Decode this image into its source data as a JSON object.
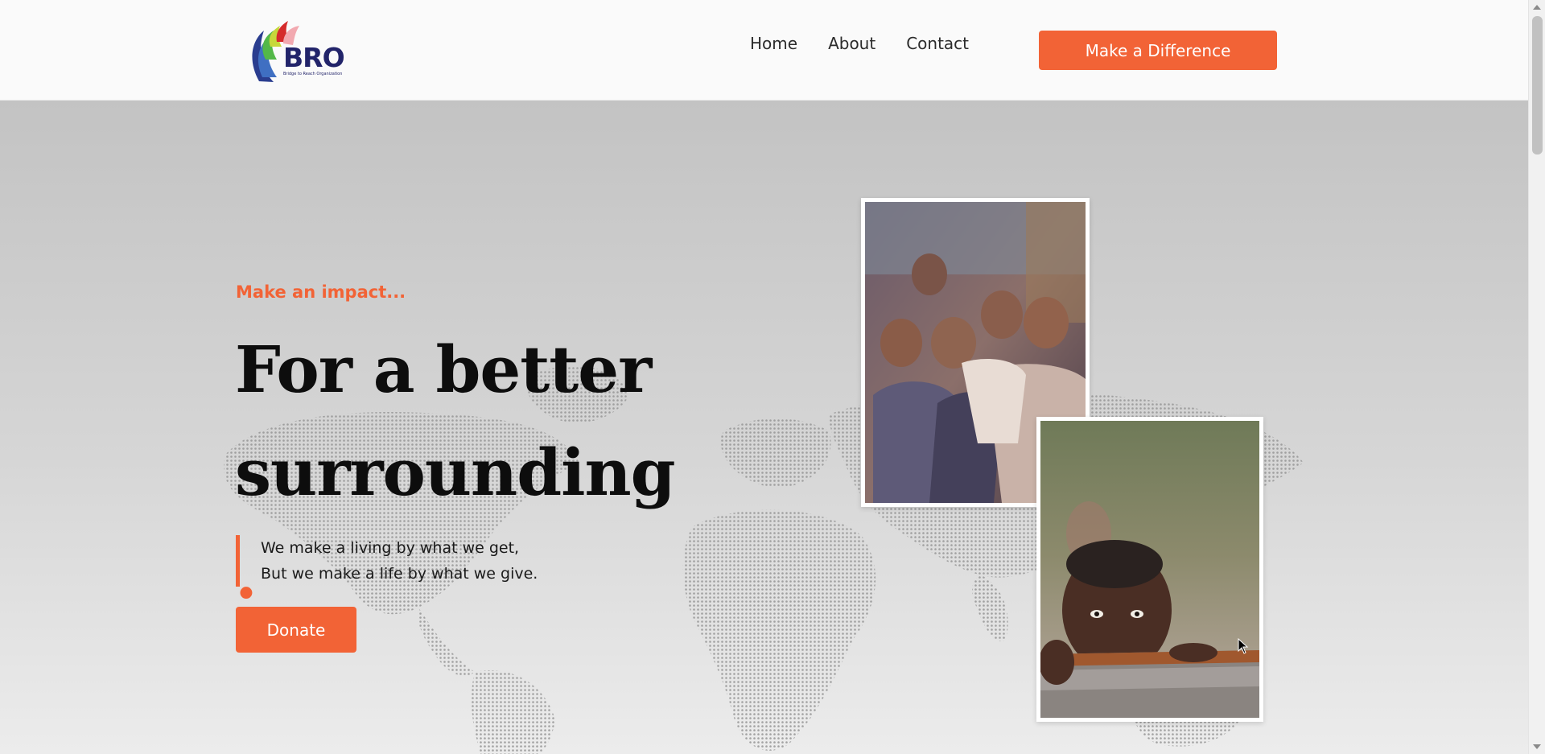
{
  "brand": {
    "logo_text": "BRO",
    "logo_subtext": "Bridge to Reach Organization",
    "colors": {
      "accent": "#f26336",
      "navy": "#22246a"
    }
  },
  "nav": {
    "items": [
      {
        "label": "Home"
      },
      {
        "label": "About"
      },
      {
        "label": "Contact"
      }
    ],
    "cta_label": "Make a Difference"
  },
  "hero": {
    "tagline": "Make an impact...",
    "headline_line1": "For a better",
    "headline_line2": "surrounding",
    "headline_dot": ".",
    "quote_line1": "We make a living by what we get,",
    "quote_line2": "But we make a life by what we give.",
    "donate_label": "Donate",
    "images": [
      "photo-children-group",
      "photo-child-portrait"
    ],
    "background": "world-map-dots"
  }
}
